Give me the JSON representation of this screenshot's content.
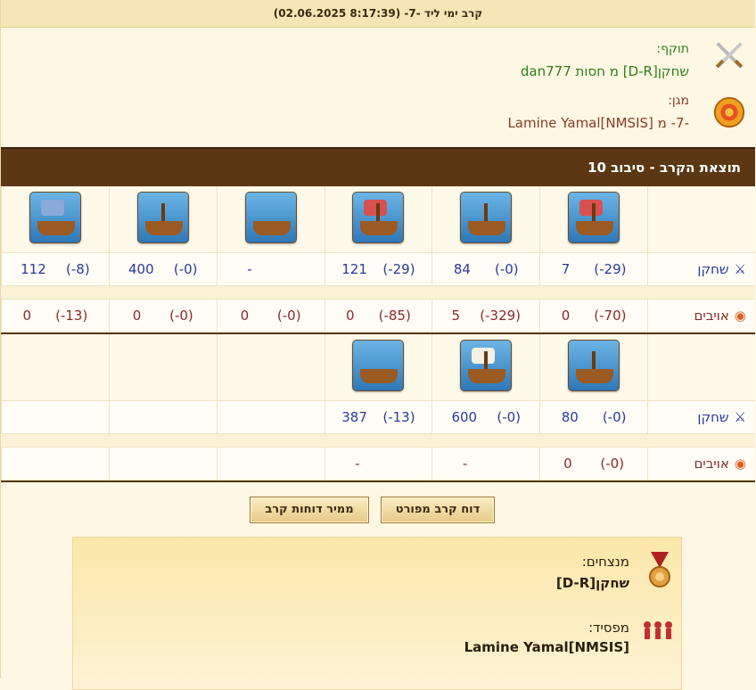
{
  "header": {
    "title": "קרב ימי ליד -7- (8:17:39 02.06.2025)"
  },
  "attacker": {
    "label": "תוקף:",
    "value": "שחקן[D-R] מ חסות dan777",
    "icon": "crossed-swords-icon"
  },
  "defender": {
    "label": "מגן:",
    "value": "-7- מ Lamine Yamal[NMSIS]",
    "icon": "shield-icon"
  },
  "round": {
    "title": "תוצאת הקרב - סיבוב 10"
  },
  "rows": {
    "player_label": "שחקן",
    "enemy_label": "אויבים"
  },
  "group1": {
    "player": [
      [
        "7",
        "(-29)"
      ],
      [
        "84",
        "(-0)"
      ],
      [
        "121",
        "(-29)"
      ],
      [
        "-",
        ""
      ],
      [
        "400",
        "(-0)"
      ],
      [
        "112",
        "(-8)"
      ]
    ],
    "enemy": [
      [
        "0",
        "(-70)"
      ],
      [
        "5",
        "(-329)"
      ],
      [
        "0",
        "(-85)"
      ],
      [
        "0",
        "(-0)"
      ],
      [
        "0",
        "(-0)"
      ],
      [
        "0",
        "(-13)"
      ]
    ]
  },
  "group2": {
    "player": [
      [
        "80",
        "(-0)"
      ],
      [
        "600",
        "(-0)"
      ],
      [
        "387",
        "(-13)"
      ]
    ],
    "enemy": [
      [
        "0",
        "(-0)"
      ],
      [
        "-",
        ""
      ],
      [
        "-",
        ""
      ]
    ]
  },
  "buttons": {
    "detailed": "דוח קרב מפורט",
    "converter": "ממיר דוחות קרב"
  },
  "summary": {
    "winners_label": "מנצחים:",
    "winners_value": "שחקן[D-R]",
    "loser_label": "מפסיד:",
    "loser_value": "Lamine Yamal[NMSIS]"
  }
}
